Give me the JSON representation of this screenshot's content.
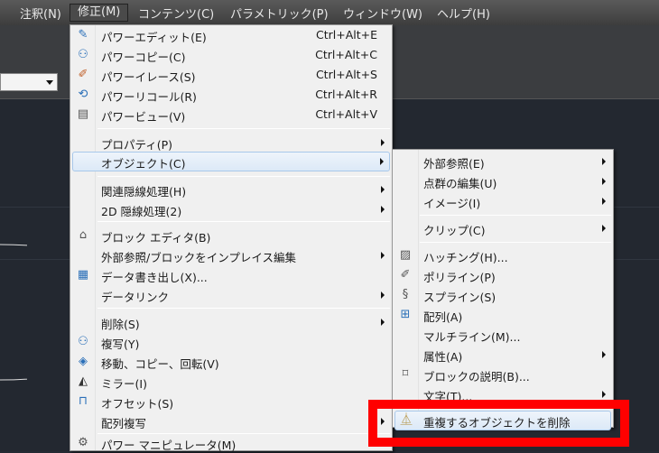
{
  "menubar": {
    "items": [
      "注釈(N)",
      "修正(M)",
      "コンテンツ(C)",
      "パラメトリック(P)",
      "ウィンドウ(W)",
      "ヘルプ(H)"
    ],
    "selected": "修正(M)"
  },
  "modify_menu": {
    "power": [
      {
        "label": "パワーエディット(E)",
        "shortcut": "Ctrl+Alt+E",
        "icon": "power-edit-icon"
      },
      {
        "label": "パワーコピー(C)",
        "shortcut": "Ctrl+Alt+C",
        "icon": "power-copy-icon"
      },
      {
        "label": "パワーイレース(S)",
        "shortcut": "Ctrl+Alt+S",
        "icon": "power-erase-icon"
      },
      {
        "label": "パワーリコール(R)",
        "shortcut": "Ctrl+Alt+R",
        "icon": "power-recall-icon"
      },
      {
        "label": "パワービュー(V)",
        "shortcut": "Ctrl+Alt+V",
        "icon": "power-view-icon"
      }
    ],
    "properties": "プロパティ(P)",
    "object": "オブジェクト(C)",
    "hide1": "関連隠線処理(H)",
    "hide2": "2D 隠線処理(2)",
    "block_editor": "ブロック エディタ(B)",
    "xref_edit": "外部参照/ブロックをインプレイス編集",
    "data_extract": "データ書き出し(X)...",
    "data_link": "データリンク",
    "erase": "削除(S)",
    "copy": "複写(Y)",
    "move_copy_rotate": "移動、コピー、回転(V)",
    "mirror": "ミラー(I)",
    "offset": "オフセット(S)",
    "array": "配列複写",
    "power_manipulator": "パワー マニピュレータ(M)"
  },
  "object_submenu": {
    "xref": "外部参照(E)",
    "point_cloud": "点群の編集(U)",
    "image": "イメージ(I)",
    "clip": "クリップ(C)",
    "hatch": "ハッチング(H)...",
    "polyline": "ポリライン(P)",
    "spline": "スプライン(S)",
    "array": "配列(A)",
    "mline": "マルチライン(M)...",
    "attribute": "属性(A)",
    "block_desc": "ブロックの説明(B)...",
    "text": "文字(T)...",
    "overkill": "重複するオブジェクトを削除"
  },
  "colors": {
    "highlight_box": "#ff0000",
    "canvas": "#232830",
    "menu": "#f0f0f0"
  }
}
